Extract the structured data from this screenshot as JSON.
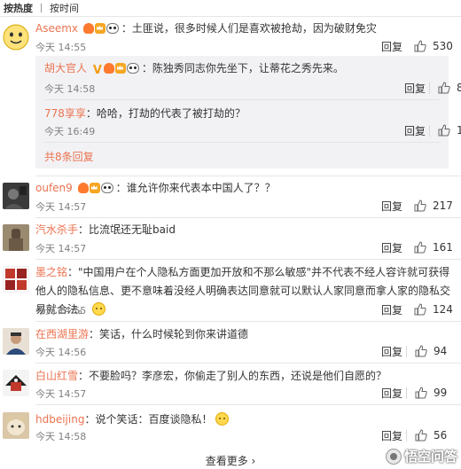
{
  "sort": {
    "hot": "按热度",
    "time": "按时间"
  },
  "comments": [
    {
      "user": "Aseemx",
      "text": "土匪说，很多时候人们是喜欢被抢劫，因为破财免灾",
      "time": "今天 14:55",
      "reply": "回复",
      "likes": "530",
      "replies": [
        {
          "user": "胡大官人",
          "text": "陈独秀同志你先坐下，让蒂花之秀先来。",
          "time": "今天 14:58",
          "reply": "回复",
          "likes": "8"
        },
        {
          "user": "778享享",
          "text": "哈哈，打劫的代表了被打劫的？",
          "time": "今天 16:49",
          "reply": "回复",
          "likes": "1"
        }
      ],
      "more_replies": "共8条回复"
    },
    {
      "user": "oufen9",
      "text": "谁允许你来代表本中国人了？？",
      "time": "今天 14:57",
      "reply": "回复",
      "likes": "217"
    },
    {
      "user": "汽水杀手",
      "text": "比流氓还无耻baid",
      "time": "今天 14:57",
      "reply": "回复",
      "likes": "161"
    },
    {
      "user": "墨之铭",
      "text": "\"中国用户在个人隐私方面更加开放和不那么敏感\"并不代表不经人容许就可获得他人的隐私信息、更不意味着没经人明确表达同意就可以默认人家同意而拿人家的隐私交易就合法。",
      "time": "今天 14:55",
      "reply": "回复",
      "likes": "124"
    },
    {
      "user": "在西湖里游",
      "text": "笑话，什么时候轮到你来讲道德",
      "time": "今天 14:56",
      "reply": "回复",
      "likes": "94"
    },
    {
      "user": "白山红雪",
      "text": "不要脸吗？李彦宏，你偷走了别人的东西，还说是他们自愿的？",
      "time": "今天 14:57",
      "reply": "回复",
      "likes": "99"
    },
    {
      "user": "hdbeijing",
      "text": "说个笑话：百度谈隐私！",
      "time": "今天 14:58",
      "reply": "回复",
      "likes": "56"
    }
  ],
  "see_more": "查看更多 ›",
  "watermark": "悟空问答",
  "colors": {
    "accent": "#eb7350",
    "reply_bg": "#f2f2f5",
    "meta": "#808080"
  }
}
